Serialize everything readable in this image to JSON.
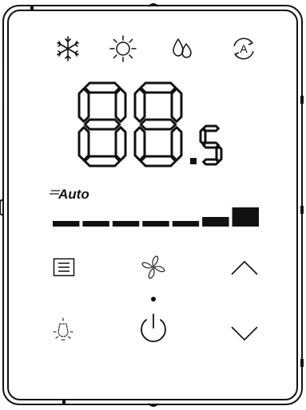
{
  "panel": {
    "name": "thermostat-control-panel"
  },
  "mode_icons": [
    {
      "name": "cool-mode-snowflake-icon"
    },
    {
      "name": "heat-mode-sun-icon"
    },
    {
      "name": "dry-mode-droplets-icon"
    },
    {
      "name": "auto-mode-icon",
      "glyph": "A"
    }
  ],
  "display": {
    "digits": "88",
    "decimal": "5",
    "digit_color": "#111111"
  },
  "fan": {
    "mode_label": "Auto",
    "level_bars": 7,
    "active_level_fraction": 1.0
  },
  "buttons": {
    "menu": {
      "name": "menu-list-icon"
    },
    "fan": {
      "name": "fan-icon"
    },
    "up": {
      "name": "chevron-up-icon"
    },
    "light": {
      "name": "light-bulb-icon"
    },
    "power": {
      "name": "power-icon"
    },
    "down": {
      "name": "chevron-down-icon"
    }
  }
}
